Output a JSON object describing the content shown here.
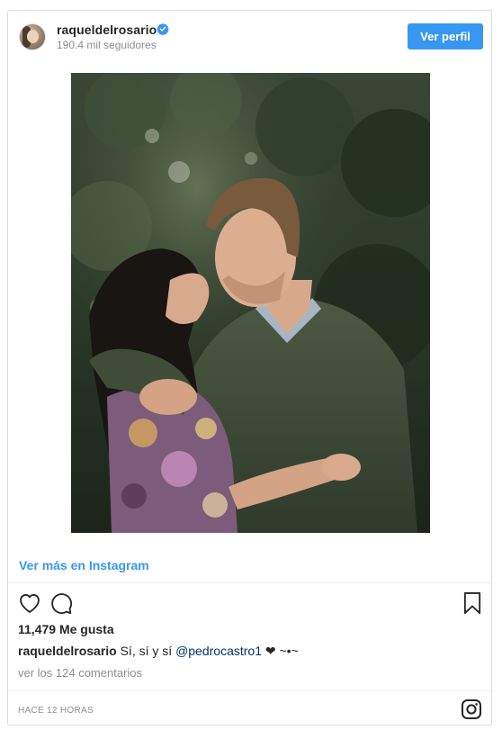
{
  "header": {
    "username": "raqueldelrosario",
    "followers": "190.4 mil seguidores",
    "profile_button": "Ver perfil",
    "verified_icon": "verified-badge-icon",
    "verified_color": "#3897f0"
  },
  "post": {
    "image_icon": "photo",
    "more_link": "Ver más en Instagram",
    "likes": "11,479 Me gusta",
    "caption": {
      "user": "raqueldelrosario",
      "text": "Sí, sí y sí",
      "mention": "@pedrocastro1",
      "suffix": "❤ ~•~"
    },
    "comments_link": "ver los 124 comentarios",
    "timestamp": "HACE 12 HORAS"
  },
  "icons": {
    "like": "heart-icon",
    "comment": "comment-icon",
    "save": "bookmark-icon",
    "brand": "instagram-logo-icon"
  },
  "colors": {
    "accent": "#3897f0",
    "mention": "#003569",
    "muted": "#8e8e8e"
  }
}
